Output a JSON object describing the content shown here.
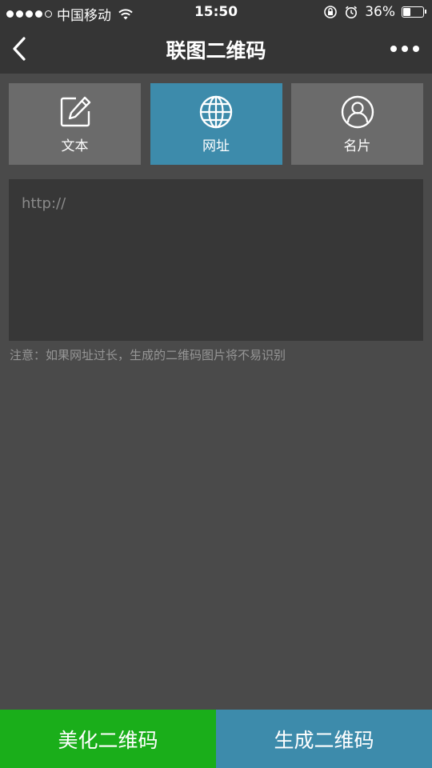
{
  "status_bar": {
    "carrier": "中国移动",
    "time": "15:50",
    "battery_percent": "36%",
    "battery_level": 0.36
  },
  "nav": {
    "title": "联图二维码"
  },
  "tabs": [
    {
      "label": "文本",
      "icon": "edit-icon",
      "active": false
    },
    {
      "label": "网址",
      "icon": "globe-icon",
      "active": true
    },
    {
      "label": "名片",
      "icon": "user-icon",
      "active": false
    }
  ],
  "url_input": {
    "placeholder": "http://",
    "value": ""
  },
  "notice": "注意：如果网址过长，生成的二维码图片将不易识别",
  "buttons": {
    "beautify": "美化二维码",
    "generate": "生成二维码"
  },
  "colors": {
    "active_tab": "#3d8bab",
    "inactive_tab": "#6b6b6b",
    "beautify_button": "#1aae1a",
    "generate_button": "#3d8bab"
  }
}
